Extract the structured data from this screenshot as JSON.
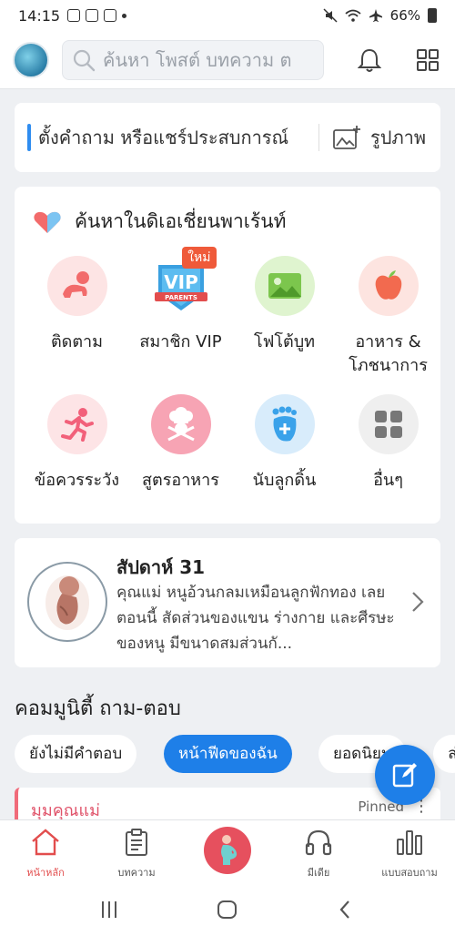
{
  "status": {
    "time": "14:15",
    "battery": "66%"
  },
  "header": {
    "search_placeholder": "ค้นหา โพสต์ บทความ ต",
    "icons": [
      "avatar",
      "search-icon",
      "bell-icon",
      "grid-icon"
    ]
  },
  "ask": {
    "prompt": "ตั้งคำถาม หรือแชร์ประสบการณ์",
    "photo_label": "รูปภาพ"
  },
  "explore": {
    "title": "ค้นหาในดิเอเชี่ยนพาเร้นท์",
    "items": [
      {
        "label": "ติดตาม",
        "icon": "baby-crawl-icon",
        "bg": "#fde4e4",
        "color": "#f26b6b"
      },
      {
        "label": "สมาชิก VIP",
        "icon": "vip-badge-icon",
        "bg": "#ffffff",
        "badge": "ใหม่"
      },
      {
        "label": "โฟโต้บูท",
        "icon": "picture-icon",
        "bg": "#dff4cf",
        "color": "#7cc64d"
      },
      {
        "label": "อาหาร & โภชนาการ",
        "icon": "apple-icon",
        "bg": "#fde4e0",
        "color": "#f26a4f"
      },
      {
        "label": "ข้อควรระวัง",
        "icon": "running-icon",
        "bg": "#fde4e6",
        "color": "#f2607a"
      },
      {
        "label": "สูตรอาหาร",
        "icon": "chef-icon",
        "bg": "#f7a4b4",
        "color": "#ffffff"
      },
      {
        "label": "นับลูกดิ้น",
        "icon": "foot-plus-icon",
        "bg": "#d8ecfb",
        "color": "#3aa2ea"
      },
      {
        "label": "อื่นๆ",
        "icon": "more-grid-icon",
        "bg": "#efefef",
        "color": "#777777"
      }
    ]
  },
  "week": {
    "title": "สัปดาห์ 31",
    "description": "คุณแม่ หนูอ้วนกลมเหมือนลูกฟักทอง เลยตอนนี้ สัดส่วนของแขน ร่างกาย และศีรษะของหนู มีขนาดสมส่วนกั..."
  },
  "community": {
    "title": "คอมมูนิตี้ ถาม-ตอบ",
    "chips": [
      "ยังไม่มีคำตอบ",
      "หน้าฟีดของฉัน",
      "ยอดนิยม",
      "ล่"
    ],
    "active_chip": 1,
    "post": {
      "category": "มุมคุณแม่",
      "pinned": "Pinned",
      "more": "⋮"
    }
  },
  "bottom_nav": {
    "items": [
      "หน้าหลัก",
      "บทความ",
      "",
      "มีเดีย",
      "แบบสอบถาม"
    ],
    "active": 0
  },
  "colors": {
    "accent": "#1e7fe8",
    "brand_red": "#e24d4d",
    "background": "#eef0f3"
  }
}
